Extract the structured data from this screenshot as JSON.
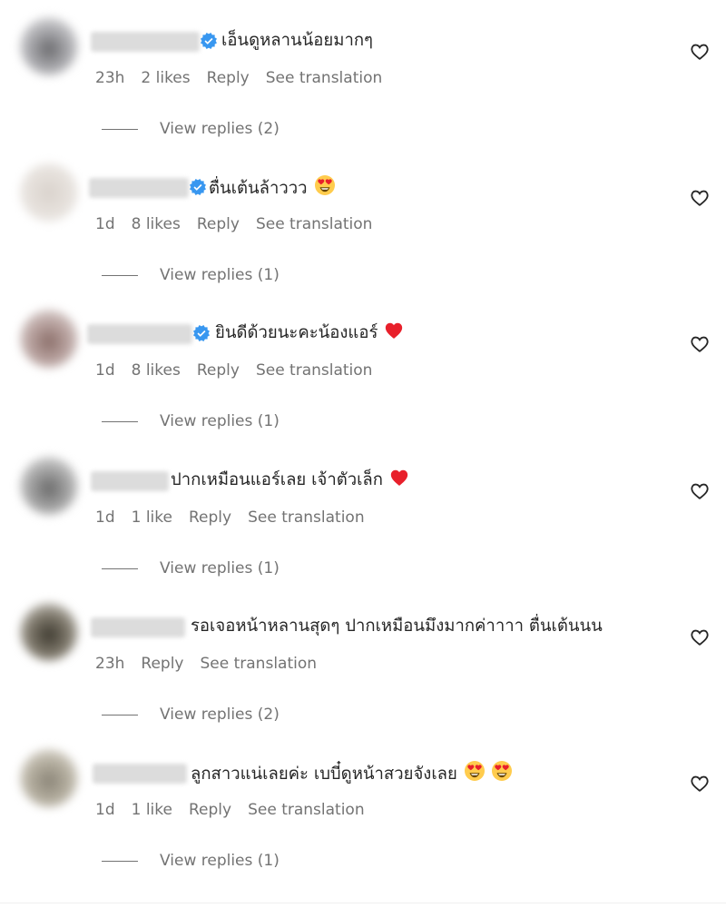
{
  "comments": [
    {
      "text": "เอ็นดูหลานน้อยมากๆ",
      "verified": true,
      "emojis": [],
      "time": "23h",
      "likes": "2 likes",
      "reply_label": "Reply",
      "translate_label": "See translation",
      "view_replies": "View replies (2)"
    },
    {
      "text": "ตื่นเต้นล้าววว",
      "verified": true,
      "emojis": [
        "heart-eyes"
      ],
      "time": "1d",
      "likes": "8 likes",
      "reply_label": "Reply",
      "translate_label": "See translation",
      "view_replies": "View replies (1)"
    },
    {
      "text": "ยินดีด้วยนะคะน้องแอร์",
      "verified": true,
      "emojis": [
        "red-heart"
      ],
      "time": "1d",
      "likes": "8 likes",
      "reply_label": "Reply",
      "translate_label": "See translation",
      "view_replies": "View replies (1)"
    },
    {
      "text": "ปากเหมือนแอร์เลย เจ้าตัวเล็ก",
      "verified": false,
      "emojis": [
        "red-heart"
      ],
      "time": "1d",
      "likes": "1 like",
      "reply_label": "Reply",
      "translate_label": "See translation",
      "view_replies": "View replies (1)"
    },
    {
      "text": "รอเจอหน้าหลานสุดๆ ปากเหมือนมึงมากค่าาาา ตื่นเต้นนน",
      "verified": false,
      "emojis": [],
      "time": "23h",
      "likes": "",
      "reply_label": "Reply",
      "translate_label": "See translation",
      "view_replies": "View replies (2)"
    },
    {
      "text": "ลูกสาวแน่เลยค่ะ เบบี๋ดูหน้าสวยจังเลย",
      "verified": false,
      "emojis": [
        "heart-eyes",
        "heart-eyes"
      ],
      "time": "1d",
      "likes": "1 like",
      "reply_label": "Reply",
      "translate_label": "See translation",
      "view_replies": "View replies (1)"
    }
  ],
  "icons": {
    "verified": "verified-badge-icon",
    "like": "heart-outline-icon"
  },
  "colors": {
    "verified_blue": "#3897f0",
    "muted_text": "#737373",
    "primary_text": "#262626",
    "heart_red": "#e8202b"
  }
}
